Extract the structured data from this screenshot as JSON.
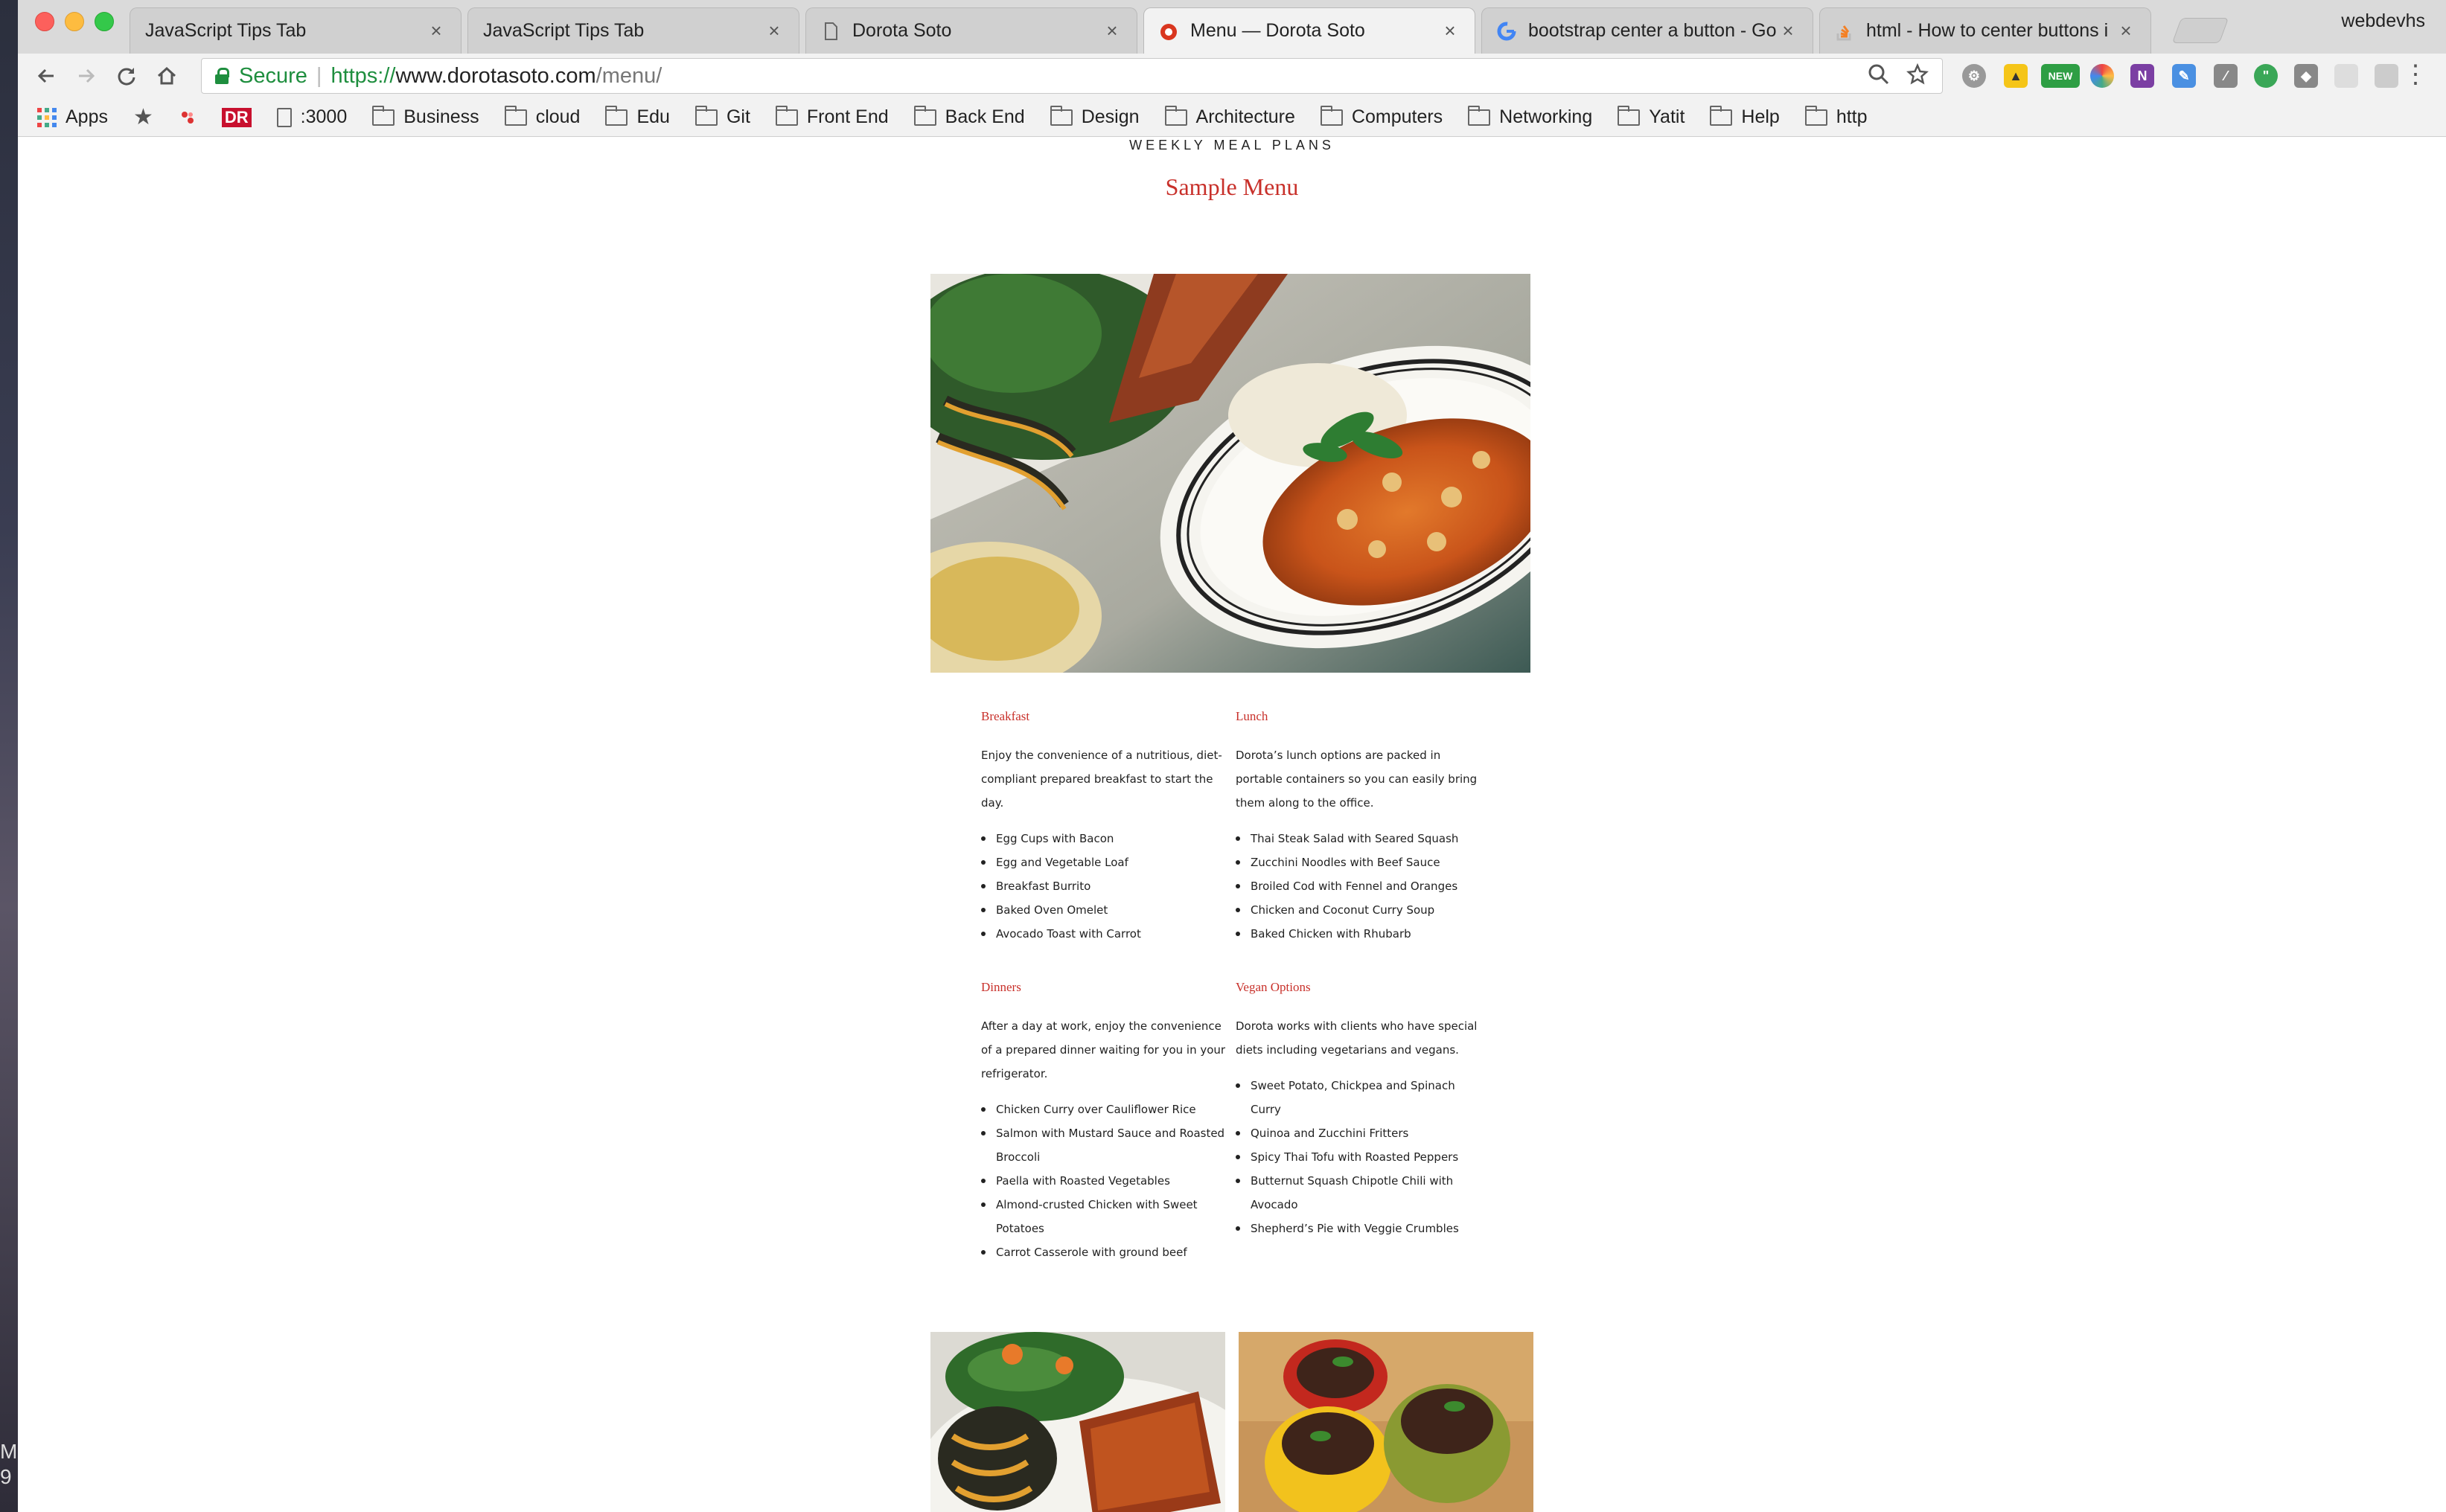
{
  "browser": {
    "tabs": [
      {
        "label": "JavaScript Tips Tab",
        "icon": "none"
      },
      {
        "label": "JavaScript Tips Tab",
        "icon": "none"
      },
      {
        "label": "Dorota Soto",
        "icon": "page-icon"
      },
      {
        "label": "Menu — Dorota Soto",
        "icon": "site-favicon",
        "active": true
      },
      {
        "label": "bootstrap center a button - Go",
        "icon": "google-icon"
      },
      {
        "label": "html - How to center buttons i",
        "icon": "stackoverflow-icon"
      }
    ],
    "profile_name": "webdevhs",
    "secure_label": "Secure",
    "url": {
      "scheme": "https://",
      "host": "www.dorotasoto.com",
      "path": "/menu/"
    },
    "bookmarks": {
      "apps": "Apps",
      "dr_badge": "DR",
      "localhost": ":3000",
      "folders": [
        "Business",
        "cloud",
        "Edu",
        "Git",
        "Front End",
        "Back End",
        "Design",
        "Architecture",
        "Computers",
        "Networking",
        "Yatit",
        "Help",
        "http"
      ]
    }
  },
  "desktop": {
    "text_line1": "M",
    "text_line2": "9"
  },
  "page": {
    "kicker": "WEEKLY MEAL PLANS",
    "title": "Sample Menu",
    "sections": {
      "breakfast": {
        "heading": "Breakfast",
        "description": "Enjoy the convenience of a nutritious, diet-compliant prepared breakfast to start the day.",
        "items": [
          "Egg Cups with Bacon",
          "Egg and Vegetable Loaf",
          "Breakfast Burrito",
          "Baked Oven Omelet",
          "Avocado Toast with Carrot"
        ]
      },
      "lunch": {
        "heading": "Lunch",
        "description": "Dorota’s lunch options are packed in portable containers so you can easily bring them along to the office.",
        "items": [
          "Thai Steak Salad with Seared Squash",
          "Zucchini Noodles with Beef Sauce",
          "Broiled Cod with Fennel and Oranges",
          "Chicken and Coconut Curry Soup",
          "Baked Chicken with Rhubarb"
        ]
      },
      "dinners": {
        "heading": "Dinners",
        "description": "After a day at work, enjoy the convenience of a prepared dinner waiting for you in your refrigerator.",
        "items": [
          "Chicken Curry over Cauliflower Rice",
          "Salmon with Mustard Sauce and Roasted Broccoli",
          "Paella with Roasted Vegetables",
          "Almond-crusted Chicken with Sweet Potatoes",
          "Carrot Casserole with ground beef"
        ]
      },
      "vegan": {
        "heading": "Vegan Options",
        "description": "Dorota works with clients who have special diets including vegetarians and vegans.",
        "items": [
          "Sweet Potato, Chickpea and Spinach Curry",
          "Quinoa and Zucchini Fritters",
          "Spicy Thai Tofu with Roasted Peppers",
          "Butternut Squash Chipotle Chili with Avocado",
          "Shepherd’s Pie with Veggie Crumbles"
        ]
      }
    }
  },
  "colors": {
    "accent": "#c8302a",
    "secure_green": "#1e8e3e",
    "text": "#222222"
  }
}
